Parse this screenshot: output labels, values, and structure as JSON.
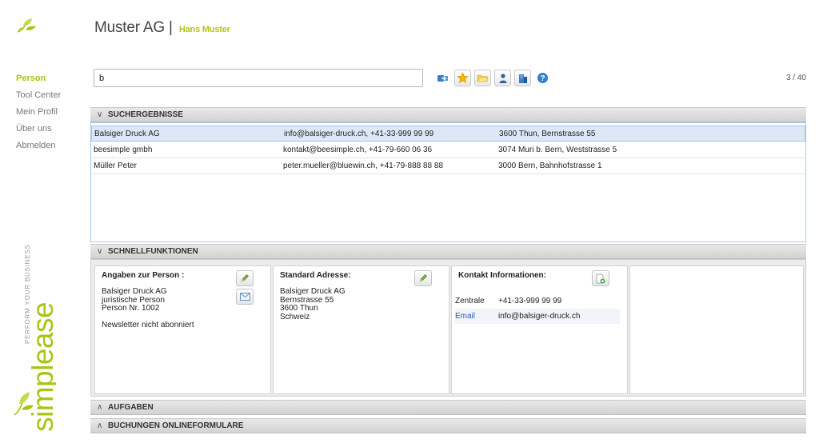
{
  "header": {
    "title": "Muster AG",
    "separator": "|",
    "user": "Hans Muster"
  },
  "nav": {
    "items": [
      {
        "label": "Person",
        "active": true
      },
      {
        "label": "Tool Center",
        "active": false
      },
      {
        "label": "Mein Profil",
        "active": false
      },
      {
        "label": "Über uns",
        "active": false
      },
      {
        "label": "Abmelden",
        "active": false
      }
    ]
  },
  "brand": {
    "name": "simplease",
    "tagline": "PERFORM YOUR BUSINESS"
  },
  "search": {
    "value": "b",
    "placeholder": ""
  },
  "toolbar": {
    "icons": [
      "import-icon",
      "star-icon",
      "folder-icon",
      "person-icon",
      "building-icon",
      "help-icon"
    ]
  },
  "counter": "3 / 40",
  "results": {
    "header": "SUCHERGEBNISSE",
    "rows": [
      {
        "name": "Balsiger Druck AG",
        "contact": "info@balsiger-druck.ch, +41-33-999 99 99",
        "address": "3600 Thun, Bernstrasse 55",
        "selected": true
      },
      {
        "name": "beesimple gmbh",
        "contact": "kontakt@beesimple.ch, +41-79-660 06 36",
        "address": "3074 Muri b. Bern, Weststrasse 5",
        "selected": false
      },
      {
        "name": "Müller Peter",
        "contact": "peter.mueller@bluewin.ch, +41-79-888 88 88",
        "address": "3000 Bern, Bahnhofstrasse 1",
        "selected": false
      }
    ]
  },
  "quick": {
    "header": "SCHNELLFUNKTIONEN",
    "person": {
      "title": "Angaben zur Person :",
      "lines": [
        "Balsiger Druck AG",
        "juristische Person",
        "Person Nr. 1002"
      ],
      "newsletter": "Newsletter nicht abonniert"
    },
    "address": {
      "title": "Standard Adresse:",
      "lines": [
        "Balsiger Druck AG",
        "Bernstrasse 55",
        "3600 Thun",
        "Schweiz"
      ]
    },
    "contact": {
      "title": "Kontakt Informationen:",
      "rows": [
        {
          "key": "Zentrale",
          "value": "+41-33-999 99 99"
        },
        {
          "key": "Email",
          "value": "info@balsiger-druck.ch"
        }
      ]
    }
  },
  "sections": {
    "tasks": "AUFGABEN",
    "bookings": "BUCHUNGEN ONLINEFORMULARE"
  },
  "colors": {
    "accent": "#a8c414",
    "selection": "#dce8f7",
    "link": "#2a5db0"
  }
}
